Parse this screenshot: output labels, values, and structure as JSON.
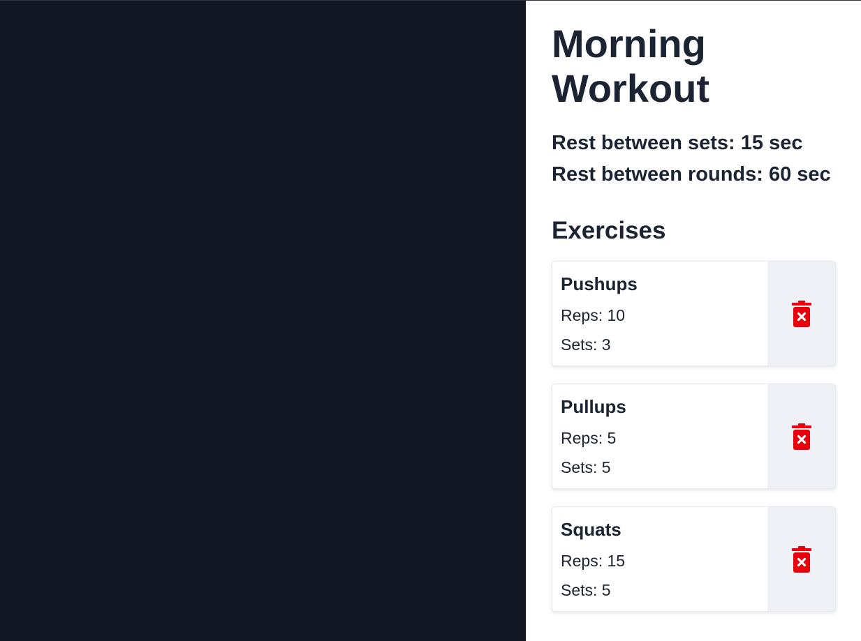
{
  "workout": {
    "title": "Morning Workout",
    "rest_sets": "Rest between sets: 15 sec",
    "rest_rounds": "Rest between rounds: 60 sec"
  },
  "exercises_heading": "Exercises",
  "exercises": [
    {
      "name": "Pushups",
      "reps": "Reps: 10",
      "sets": "Sets: 3"
    },
    {
      "name": "Pullups",
      "reps": "Reps: 5",
      "sets": "Sets: 5"
    },
    {
      "name": "Squats",
      "reps": "Reps: 15",
      "sets": "Sets: 5"
    }
  ],
  "icons": {
    "delete": "trash-x-icon"
  },
  "colors": {
    "background": "#121723",
    "panel": "#ffffff",
    "text": "#1c2434",
    "delete_icon": "#e8000d",
    "delete_bg": "#eef2f6"
  }
}
